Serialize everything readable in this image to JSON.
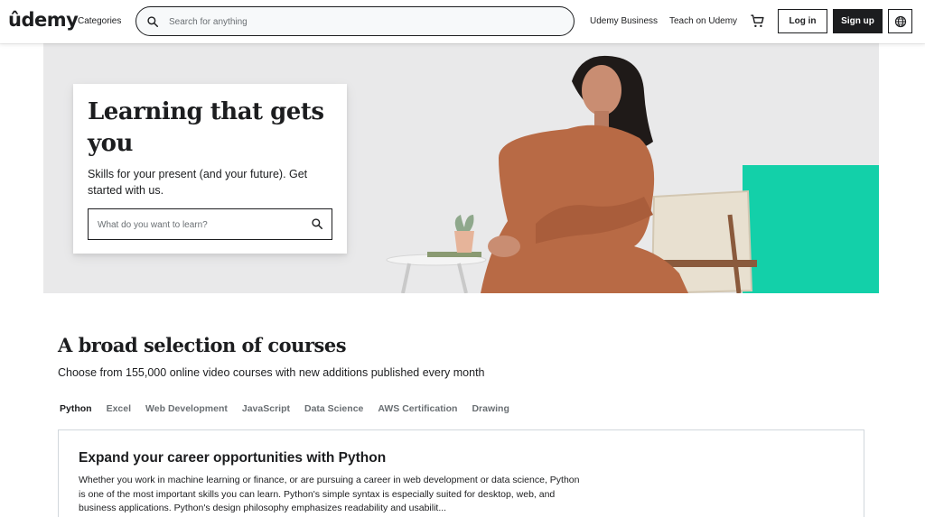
{
  "header": {
    "logo_text": "ûdemy",
    "categories_label": "Categories",
    "search_placeholder": "Search for anything",
    "business_link": "Udemy Business",
    "teach_link": "Teach on Udemy",
    "login_label": "Log in",
    "signup_label": "Sign up",
    "icons": {
      "search": "search-icon",
      "cart": "cart-icon",
      "language": "globe-icon"
    }
  },
  "hero": {
    "title": "Learning that gets you",
    "subtitle": "Skills for your present (and your future). Get started with us.",
    "search_placeholder": "What do you want to learn?",
    "accent_color": "#13d0a9"
  },
  "section": {
    "title": "A broad selection of courses",
    "subtitle": "Choose from 155,000 online video courses with new additions published every month",
    "tabs": [
      {
        "label": "Python",
        "active": true
      },
      {
        "label": "Excel",
        "active": false
      },
      {
        "label": "Web Development",
        "active": false
      },
      {
        "label": "JavaScript",
        "active": false
      },
      {
        "label": "Data Science",
        "active": false
      },
      {
        "label": "AWS Certification",
        "active": false
      },
      {
        "label": "Drawing",
        "active": false
      }
    ]
  },
  "course_panel": {
    "title": "Expand your career opportunities with Python",
    "description": "Whether you work in machine learning or finance, or are pursuing a career in web development or data science, Python is one of the most important skills you can learn. Python's simple syntax is especially suited for desktop, web, and business applications. Python's design philosophy emphasizes readability and usabilit..."
  }
}
